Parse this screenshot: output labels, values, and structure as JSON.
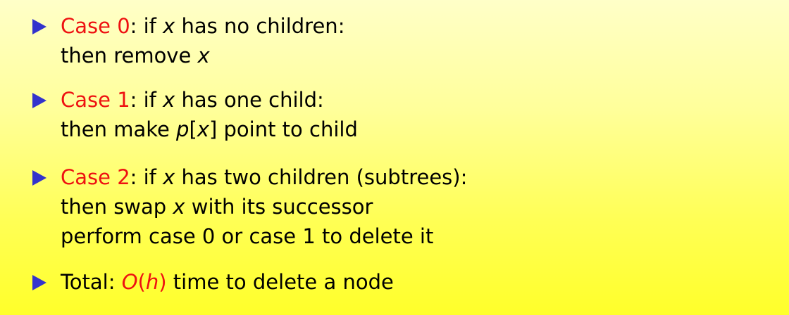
{
  "items": [
    {
      "case_label": "Case 0",
      "line1": {
        "pre": ": if ",
        "var": "x",
        "post": " has no children:"
      },
      "line2": {
        "pre": "then remove ",
        "var": "x",
        "post": ""
      }
    },
    {
      "case_label": "Case 1",
      "line1": {
        "pre": ": if ",
        "var": "x",
        "post": " has one child:"
      },
      "line2": {
        "pre": "then make ",
        "var": "p",
        "bracket_open": "[",
        "var2": "x",
        "bracket_close": "]",
        "post": " point to child"
      }
    },
    {
      "case_label": "Case 2",
      "line1": {
        "pre": ": if ",
        "var": "x",
        "post": " has two children (subtrees):"
      },
      "line2": {
        "pre": "then swap ",
        "var": "x",
        "post": " with its successor"
      },
      "line3": "perform case 0 or case 1 to delete it"
    },
    {
      "total_label": "Total: ",
      "complexity": {
        "O": "O",
        "open": "(",
        "var": "h",
        "close": ")"
      },
      "post": " time to delete a node"
    }
  ],
  "colors": {
    "accent": "#ee1111",
    "bullet": "#3333cc",
    "background_top": "#ffffc8",
    "background_bottom": "#ffff2a"
  }
}
